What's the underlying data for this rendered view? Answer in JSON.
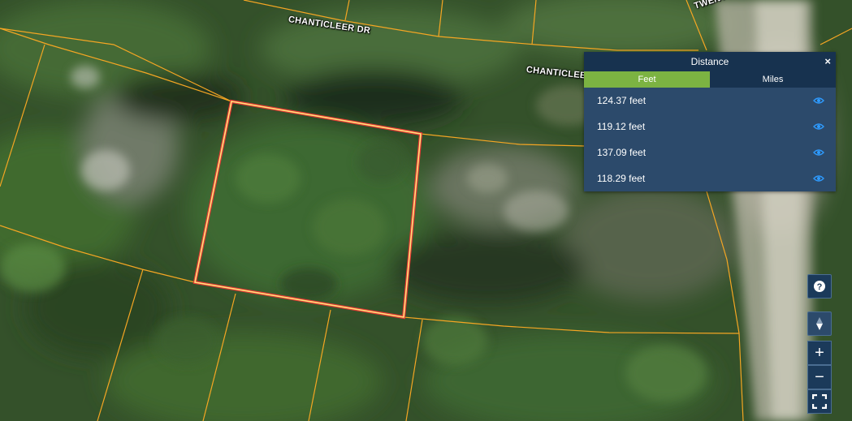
{
  "map": {
    "streets": {
      "chanticleer_dr_1": "CHANTICLEER DR",
      "chanticleer_dr_2": "CHANTICLEER",
      "twenty_sixth": "TWENTY SIXTH"
    }
  },
  "distance_panel": {
    "title": "Distance",
    "close_label": "×",
    "tabs": [
      {
        "label": "Feet",
        "active": true
      },
      {
        "label": "Miles",
        "active": false
      }
    ],
    "measurements": [
      {
        "value": "124.37 feet"
      },
      {
        "value": "119.12 feet"
      },
      {
        "value": "137.09 feet"
      },
      {
        "value": "118.29 feet"
      }
    ]
  },
  "controls": {
    "help_label": "?",
    "zoom_in_label": "+",
    "zoom_out_label": "−"
  },
  "colors": {
    "parcel_line": "#f5a623",
    "selection_outer": "#e53935",
    "selection_inner": "#ffe27a",
    "panel_bg": "#2c4a6b",
    "panel_header": "#17324f",
    "active_tab": "#7cb342",
    "eye_icon": "#2e9bff"
  }
}
